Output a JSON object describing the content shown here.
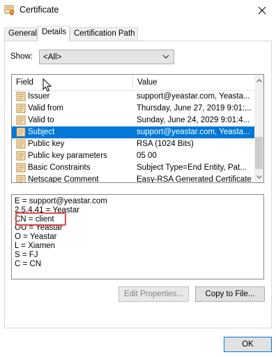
{
  "window": {
    "title": "Certificate",
    "icon": "certificate-icon"
  },
  "tabs": [
    {
      "label": "General",
      "active": false
    },
    {
      "label": "Details",
      "active": true
    },
    {
      "label": "Certification Path",
      "active": false
    }
  ],
  "show": {
    "label": "Show:",
    "selected": "<All>"
  },
  "list": {
    "columns": [
      "Field",
      "Value"
    ],
    "rows": [
      {
        "field": "Issuer",
        "value": "support@yeastar.com, Yeasta...",
        "selected": false
      },
      {
        "field": "Valid from",
        "value": "Thursday, June 27, 2019 9:01:...",
        "selected": false
      },
      {
        "field": "Valid to",
        "value": "Sunday, June 24, 2029 9:01:4...",
        "selected": false
      },
      {
        "field": "Subject",
        "value": "support@yeastar.com, Yeasta...",
        "selected": true
      },
      {
        "field": "Public key",
        "value": "RSA (1024 Bits)",
        "selected": false
      },
      {
        "field": "Public key parameters",
        "value": "05 00",
        "selected": false
      },
      {
        "field": "Basic Constraints",
        "value": "Subject Type=End Entity, Pat...",
        "selected": false
      },
      {
        "field": "Netscape Comment",
        "value": "Easy-RSA Generated Certificate",
        "selected": false
      }
    ]
  },
  "details": {
    "lines": [
      "E = support@yeastar.com",
      "2.5.4.41 = Yeastar",
      "CN = client",
      "OU = Yeastar",
      "O = Yeastar",
      "L = Xiamen",
      "S = FJ",
      "C = CN"
    ]
  },
  "buttons": {
    "edit_properties": "Edit Properties...",
    "copy_to_file": "Copy to File...",
    "ok": "OK"
  },
  "colors": {
    "selection": "#0078d7",
    "highlight_annotation": "#e8494b"
  }
}
